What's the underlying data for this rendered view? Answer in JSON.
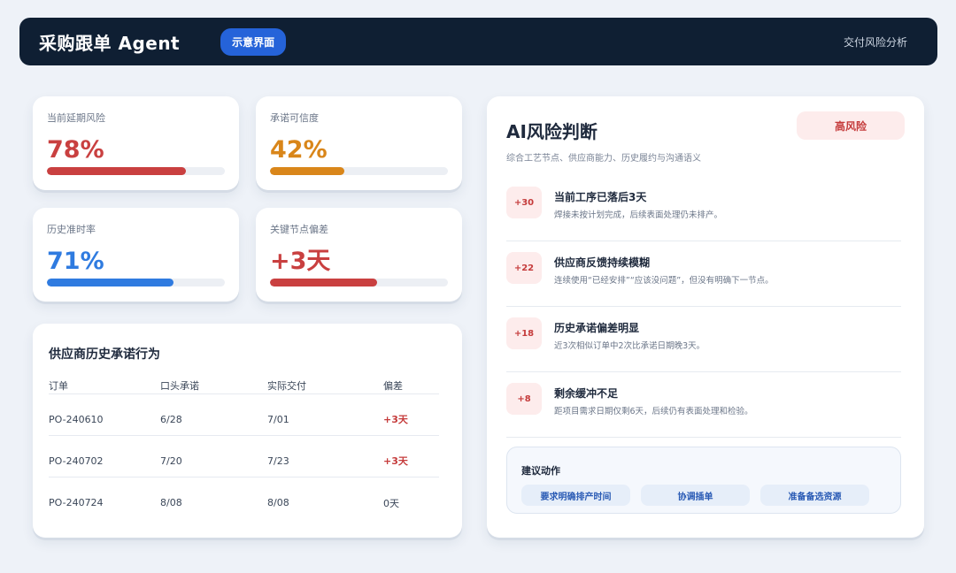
{
  "header": {
    "title": "采购跟单 Agent",
    "badge": "示意界面",
    "link": "交付风险分析"
  },
  "metrics": [
    {
      "label": "当前延期风险",
      "value": "78%",
      "progress": 78,
      "color": "#c94040"
    },
    {
      "label": "承诺可信度",
      "value": "42%",
      "progress": 42,
      "color": "#d9861a"
    },
    {
      "label": "历史准时率",
      "value": "71%",
      "progress": 71,
      "color": "#2f7be0"
    },
    {
      "label": "关键节点偏差",
      "value": "+3天",
      "progress": 60,
      "color": "#c94040"
    }
  ],
  "history": {
    "title": "供应商历史承诺行为",
    "columns": [
      "订单",
      "口头承诺",
      "实际交付",
      "偏差"
    ],
    "rows": [
      [
        "PO-240610",
        "6/28",
        "7/01",
        "+3天"
      ],
      [
        "PO-240702",
        "7/20",
        "7/23",
        "+3天"
      ],
      [
        "PO-240724",
        "8/08",
        "8/08",
        "0天"
      ]
    ]
  },
  "ai": {
    "title": "AI风险判断",
    "subtitle": "综合工艺节点、供应商能力、历史履约与沟通语义",
    "risk_badge": "高风险",
    "factors": [
      {
        "score": "+30",
        "title": "当前工序已落后3天",
        "desc": "焊接未按计划完成，后续表面处理仍未排产。"
      },
      {
        "score": "+22",
        "title": "供应商反馈持续模糊",
        "desc": "连续使用“已经安排”“应该没问题”，但没有明确下一节点。"
      },
      {
        "score": "+18",
        "title": "历史承诺偏差明显",
        "desc": "近3次相似订单中2次比承诺日期晚3天。"
      },
      {
        "score": "+8",
        "title": "剩余缓冲不足",
        "desc": "距项目需求日期仅剩6天，后续仍有表面处理和检验。"
      }
    ],
    "actions": {
      "title": "建议动作",
      "buttons": [
        "要求明确排产时间",
        "协调插单",
        "准备备选资源"
      ]
    }
  },
  "colors": {
    "header_bg": "#0f1f33",
    "accent_blue": "#2563d9",
    "danger": "#c53b3b",
    "danger_bg": "#fdecec"
  }
}
